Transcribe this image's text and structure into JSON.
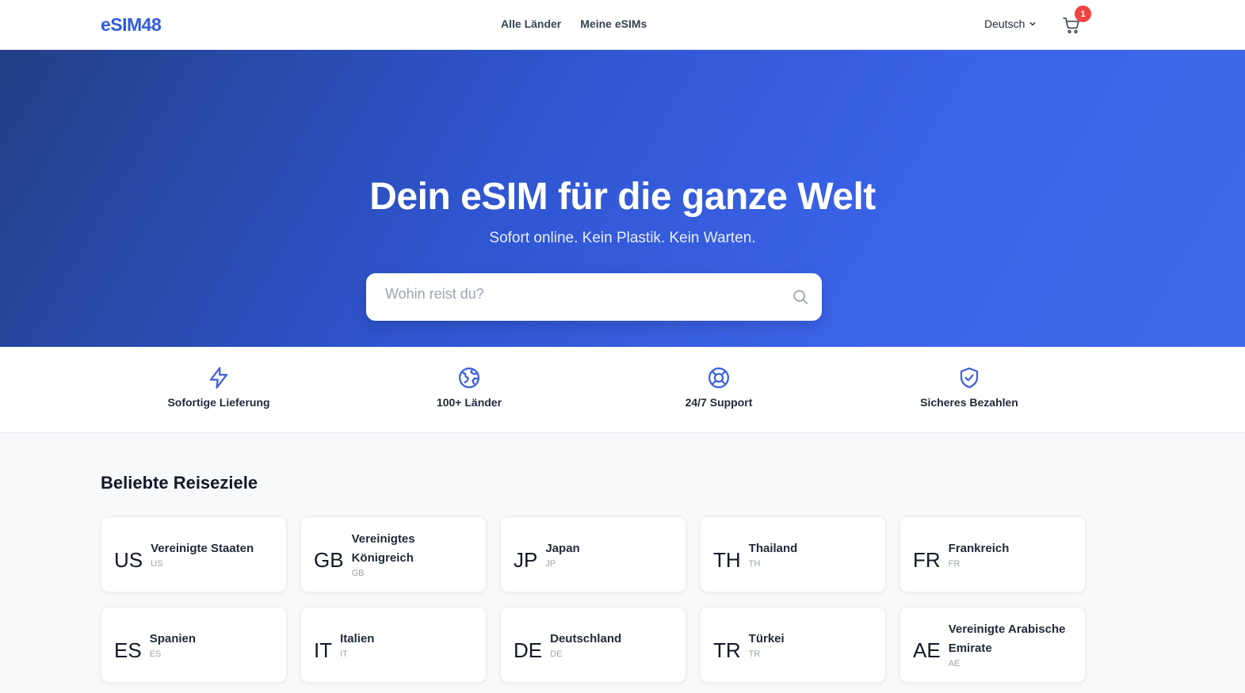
{
  "header": {
    "logo": "eSIM48",
    "nav": [
      "Alle Länder",
      "Meine eSIMs"
    ],
    "language": "Deutsch",
    "cart_count": "1"
  },
  "hero": {
    "title": "Dein eSIM für die ganze Welt",
    "subtitle": "Sofort online. Kein Plastik. Kein Warten.",
    "search_placeholder": "Wohin reist du?"
  },
  "features": [
    {
      "label": "Sofortige Lieferung",
      "icon": "bolt-icon"
    },
    {
      "label": "100+ Länder",
      "icon": "globe-icon"
    },
    {
      "label": "24/7 Support",
      "icon": "lifebuoy-icon"
    },
    {
      "label": "Sicheres Bezahlen",
      "icon": "shield-check-icon"
    }
  ],
  "destinations": {
    "title": "Beliebte Reiseziele",
    "items": [
      {
        "code": "US",
        "name": "Vereinigte Staaten",
        "sub": "US"
      },
      {
        "code": "GB",
        "name": "Vereinigtes Königreich",
        "sub": "GB"
      },
      {
        "code": "JP",
        "name": "Japan",
        "sub": "JP"
      },
      {
        "code": "TH",
        "name": "Thailand",
        "sub": "TH"
      },
      {
        "code": "FR",
        "name": "Frankreich",
        "sub": "FR"
      },
      {
        "code": "ES",
        "name": "Spanien",
        "sub": "ES"
      },
      {
        "code": "IT",
        "name": "Italien",
        "sub": "IT"
      },
      {
        "code": "DE",
        "name": "Deutschland",
        "sub": "DE"
      },
      {
        "code": "TR",
        "name": "Türkei",
        "sub": "TR"
      },
      {
        "code": "AE",
        "name": "Vereinigte Arabische Emirate",
        "sub": "AE"
      }
    ]
  },
  "colors": {
    "accent": "#2f5be0",
    "badge": "#ef4444"
  }
}
